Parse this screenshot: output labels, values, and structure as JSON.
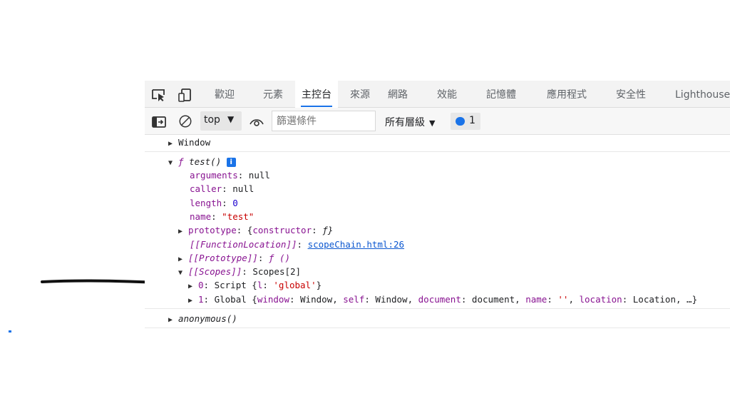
{
  "tabs": [
    "歡迎",
    "元素",
    "主控台",
    "來源",
    "網路",
    "效能",
    "記憶體",
    "應用程式",
    "安全性",
    "Lighthouse"
  ],
  "toolbar": {
    "context": "top",
    "filter_placeholder": "篩選條件",
    "levels": "所有層級",
    "issues_count": "1"
  },
  "console": {
    "window": "Window",
    "fn_prefix": "ƒ",
    "fn_name": "test()",
    "info": "i",
    "arguments_key": "arguments",
    "arguments_val": "null",
    "caller_key": "caller",
    "caller_val": "null",
    "length_key": "length",
    "length_val": "0",
    "name_key": "name",
    "name_val": "\"test\"",
    "prototype_key": "prototype",
    "prototype_val_open": "{",
    "prototype_val_key": "constructor",
    "prototype_val_close": "ƒ}",
    "funcloc_key": "[[FunctionLocation]]",
    "funcloc_val": "scopeChain.html:26",
    "proto_key": "[[Prototype]]",
    "proto_val": "ƒ ()",
    "scopes_key": "[[Scopes]]",
    "scopes_val": "Scopes[2]",
    "scope0_key": "0",
    "scope0_type": "Script",
    "scope0_prop": "l",
    "scope0_val": "'global'",
    "scope1_key": "1",
    "scope1_type": "Global",
    "scope1_p1": "window",
    "scope1_v1": "Window",
    "scope1_p2": "self",
    "scope1_v2": "Window",
    "scope1_p3": "document",
    "scope1_v3": "document",
    "scope1_p4": "name",
    "scope1_v4": "''",
    "scope1_p5": "location",
    "scope1_v5": "Location, …}",
    "anonymous": "anonymous()"
  },
  "annotation": {
    "type": "hand-drawn-arrow",
    "color": "#111111"
  }
}
